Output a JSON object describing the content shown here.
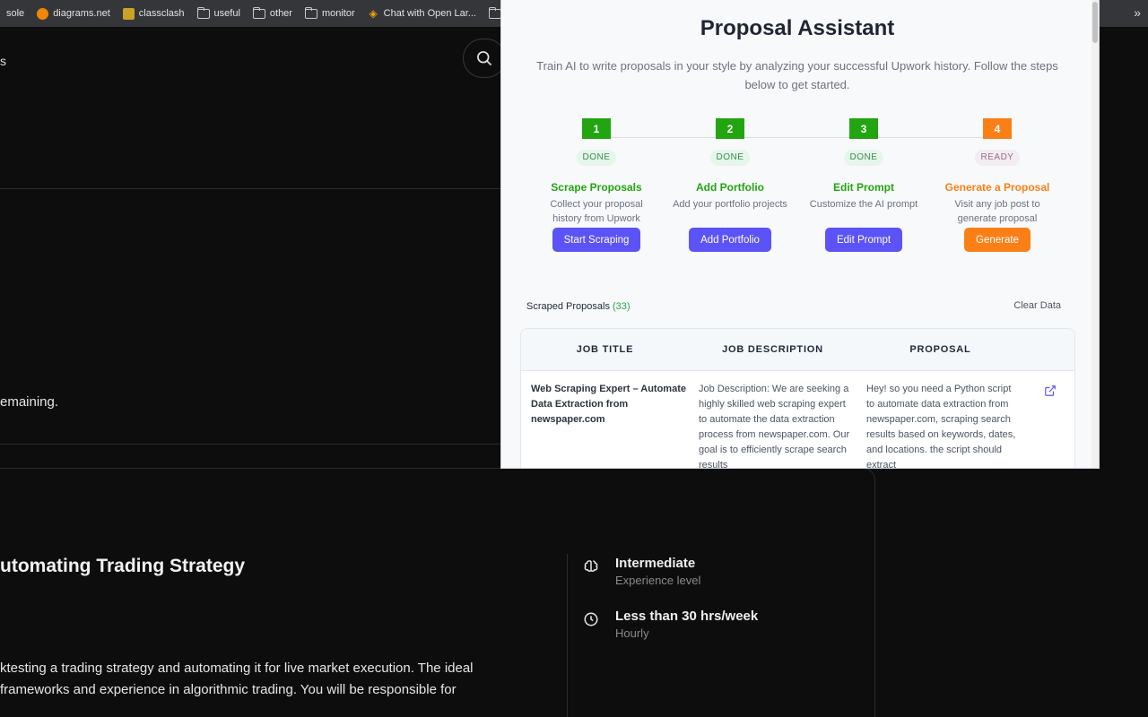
{
  "bookmarks": {
    "items": [
      {
        "label": "sole",
        "icon": "none"
      },
      {
        "label": "diagrams.net",
        "icon": "diagrams-icon"
      },
      {
        "label": "classclash",
        "icon": "classclash-icon"
      },
      {
        "label": "useful",
        "icon": "folder-icon"
      },
      {
        "label": "other",
        "icon": "folder-icon"
      },
      {
        "label": "monitor",
        "icon": "folder-icon"
      },
      {
        "label": "Chat with Open Lar...",
        "icon": "chat-icon"
      },
      {
        "label": "",
        "icon": "folder-icon"
      }
    ],
    "more": "»"
  },
  "background": {
    "logo_fragment": "s",
    "remaining_text": "emaining.",
    "job_title": "utomating Trading Strategy",
    "job_description": "ktesting a trading strategy and automating it for live market execution. The ideal frameworks and experience in algorithmic trading. You will be responsible for",
    "experience_value": "Intermediate",
    "experience_label": "Experience level",
    "hours_value": "Less than 30 hrs/week",
    "hours_label": "Hourly"
  },
  "popup": {
    "title": "Proposal Assistant",
    "subtitle": "Train AI to write proposals in your style by analyzing your successful Upwork history. Follow the steps below to get started.",
    "colors": {
      "done": "#22a511",
      "ready": "#fb7f17",
      "primary": "#5b53f5"
    },
    "steps": [
      {
        "number": "1",
        "status": "DONE",
        "name": "Scrape Proposals",
        "description": "Collect your proposal history from Upwork",
        "button": "Start Scraping"
      },
      {
        "number": "2",
        "status": "DONE",
        "name": "Add Portfolio",
        "description": "Add your portfolio projects",
        "button": "Add Portfolio"
      },
      {
        "number": "3",
        "status": "DONE",
        "name": "Edit Prompt",
        "description": "Customize the AI prompt",
        "button": "Edit Prompt"
      },
      {
        "number": "4",
        "status": "READY",
        "name": "Generate a Proposal",
        "description": "Visit any job post to generate proposal",
        "button": "Generate"
      }
    ],
    "scraped": {
      "label": "Scraped Proposals",
      "count_text": "(33)",
      "clear_label": "Clear Data"
    },
    "table": {
      "headers": [
        "JOB TITLE",
        "JOB DESCRIPTION",
        "PROPOSAL"
      ],
      "rows": [
        {
          "title": "Web Scraping Expert – Automate Data Extraction from newspaper.com",
          "description": "Job Description: We are seeking a highly skilled web scraping expert to automate the data extraction process from newspaper.com. Our goal is to efficiently scrape search results",
          "proposal": "Hey! so you need a Python script to automate data extraction from newspaper.com, scraping search results based on keywords, dates, and locations. the script should extract"
        }
      ]
    }
  }
}
